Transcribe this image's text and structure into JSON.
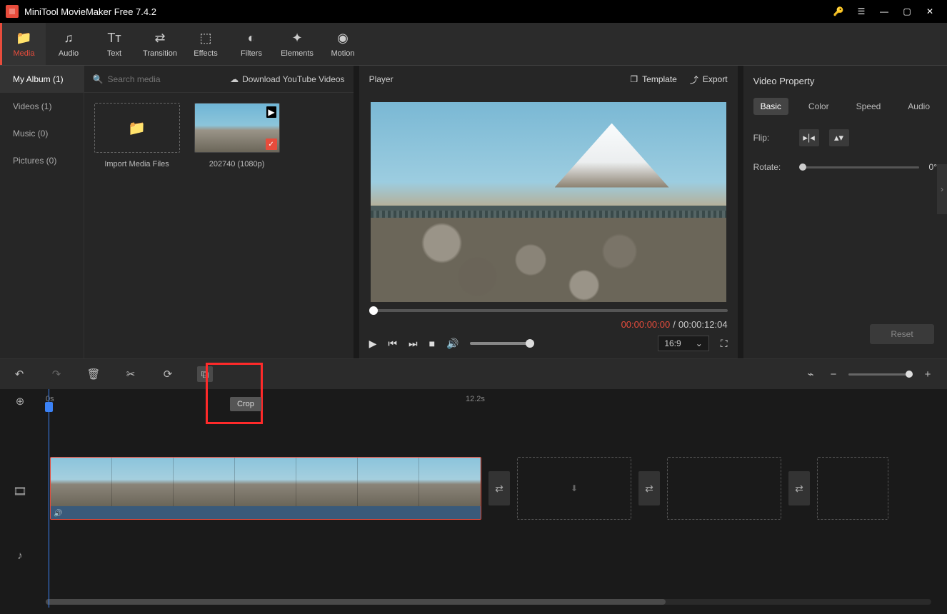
{
  "titlebar": {
    "title": "MiniTool MovieMaker Free 7.4.2"
  },
  "ribbon": [
    {
      "label": "Media",
      "active": true
    },
    {
      "label": "Audio"
    },
    {
      "label": "Text"
    },
    {
      "label": "Transition"
    },
    {
      "label": "Effects"
    },
    {
      "label": "Filters"
    },
    {
      "label": "Elements"
    },
    {
      "label": "Motion"
    }
  ],
  "sidebar": [
    {
      "label": "My Album (1)",
      "active": true
    },
    {
      "label": "Videos (1)"
    },
    {
      "label": "Music (0)"
    },
    {
      "label": "Pictures (0)"
    }
  ],
  "search": {
    "placeholder": "Search media"
  },
  "download_link": "Download YouTube Videos",
  "media": {
    "import_label": "Import Media Files",
    "clip_label": "202740 (1080p)"
  },
  "player": {
    "title": "Player",
    "template": "Template",
    "export": "Export",
    "time_cur": "00:00:00:00",
    "time_div": "/",
    "time_dur": "00:00:12:04",
    "ratio": "16:9"
  },
  "props": {
    "title": "Video Property",
    "tabs": [
      "Basic",
      "Color",
      "Speed",
      "Audio"
    ],
    "flip": "Flip:",
    "rotate": "Rotate:",
    "rotate_val": "0°",
    "reset": "Reset"
  },
  "timeline": {
    "crop_tip": "Crop",
    "ruler": {
      "t0": "0s",
      "t1": "12.2s"
    }
  }
}
